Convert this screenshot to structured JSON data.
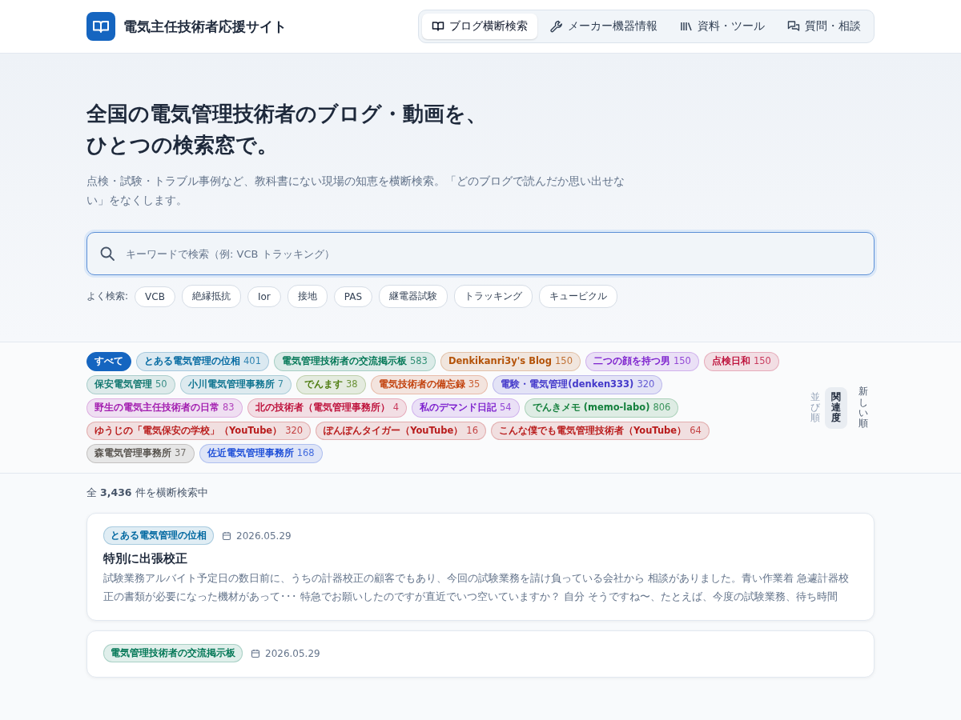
{
  "site": {
    "title": "電気主任技術者応援サイト"
  },
  "nav": [
    {
      "label": "ブログ横断検索",
      "kind": "book",
      "selected": true
    },
    {
      "label": "メーカー機器情報",
      "kind": "wrench",
      "selected": false
    },
    {
      "label": "資料・ツール",
      "kind": "library",
      "selected": false
    },
    {
      "label": "質問・相談",
      "kind": "chat",
      "selected": false
    }
  ],
  "hero": {
    "headline": [
      "全国の電気管理技術者のブログ・動画を、",
      "ひとつの検索窓で。"
    ],
    "lead": "点検・試験・トラブル事例など、教科書にない現場の知恵を横断検索。「どのブログで読んだか思い出せない」をなくします。",
    "search": {
      "placeholder": "キーワードで検索（例: VCB トラッキング）"
    },
    "popular_label": "よく検索:",
    "popular": [
      "VCB",
      "絶縁抵抗",
      "Ior",
      "接地",
      "PAS",
      "継電器試験",
      "トラッキング",
      "キュービクル"
    ]
  },
  "filters": {
    "all": {
      "label": "すべて",
      "selected": true
    },
    "sources": [
      {
        "label": "とある電気管理の位相",
        "count": "401",
        "color": "#0369a1",
        "selected": false
      },
      {
        "label": "電気管理技術者の交流掲示板",
        "count": "583",
        "color": "#047857",
        "selected": false
      },
      {
        "label": "Denkikanri3y's Blog",
        "count": "150",
        "color": "#b45309",
        "selected": false
      },
      {
        "label": "二つの顔を持つ男",
        "count": "150",
        "color": "#7e22ce",
        "selected": false
      },
      {
        "label": "点検日和",
        "count": "150",
        "color": "#be123c",
        "selected": false
      },
      {
        "label": "保安電気管理",
        "count": "50",
        "color": "#0f766e",
        "selected": false
      },
      {
        "label": "小川電気管理事務所",
        "count": "7",
        "color": "#0e7490",
        "selected": false
      },
      {
        "label": "でんます",
        "count": "38",
        "color": "#4d7c0f",
        "selected": false
      },
      {
        "label": "電気技術者の備忘録",
        "count": "35",
        "color": "#c2410c",
        "selected": false
      },
      {
        "label": "電験・電気管理(denken333)",
        "count": "320",
        "color": "#4338ca",
        "selected": false
      },
      {
        "label": "野生の電気主任技術者の日常",
        "count": "83",
        "color": "#a21caf",
        "selected": false
      },
      {
        "label": "北の技術者（電気管理事務所）",
        "count": "4",
        "color": "#be123c",
        "selected": false
      },
      {
        "label": "私のデマンド日記",
        "count": "54",
        "color": "#7e22ce",
        "selected": false
      },
      {
        "label": "でんきメモ (memo-labo)",
        "count": "806",
        "color": "#15803d",
        "selected": false
      },
      {
        "label": "ゆうじの「電気保安の学校」（YouTube）",
        "count": "320",
        "color": "#b91c1c",
        "selected": false
      },
      {
        "label": "ぽんぽんタイガー（YouTube）",
        "count": "16",
        "color": "#b91c1c",
        "selected": false
      },
      {
        "label": "こんな僕でも電気管理技術者（YouTube）",
        "count": "64",
        "color": "#b91c1c",
        "selected": false
      },
      {
        "label": "森電気管理事務所",
        "count": "37",
        "color": "#57534e",
        "selected": false
      },
      {
        "label": "佐近電気管理事務所",
        "count": "168",
        "color": "#1d4ed8",
        "selected": false
      }
    ],
    "sort_label": "並び順",
    "sort": [
      {
        "label": "関連度",
        "selected": true
      },
      {
        "label": "新しい順",
        "selected": false
      }
    ]
  },
  "results": {
    "summary": "全 **3,436** 件を横断検索中",
    "items": [
      {
        "source": "とある電気管理の位相",
        "color": "#0369a1",
        "date": "2026.05.29",
        "title": "特別に出張校正",
        "excerpt": "試験業務アルバイト予定日の数日前に、うちの計器校正の顧客でもあり、今回の試験業務を請け負っている会社から 相談がありました。青い作業着 急遽計器校正の書類が必要になった機材があって･･･ 特急でお願いしたのですが直近でいつ空いていますか？ 自分 そうですね〜、たとえば、今度の試験業務、待ち時間"
      },
      {
        "source": "電気管理技術者の交流掲示板",
        "color": "#047857",
        "date": "2026.05.29"
      }
    ]
  }
}
